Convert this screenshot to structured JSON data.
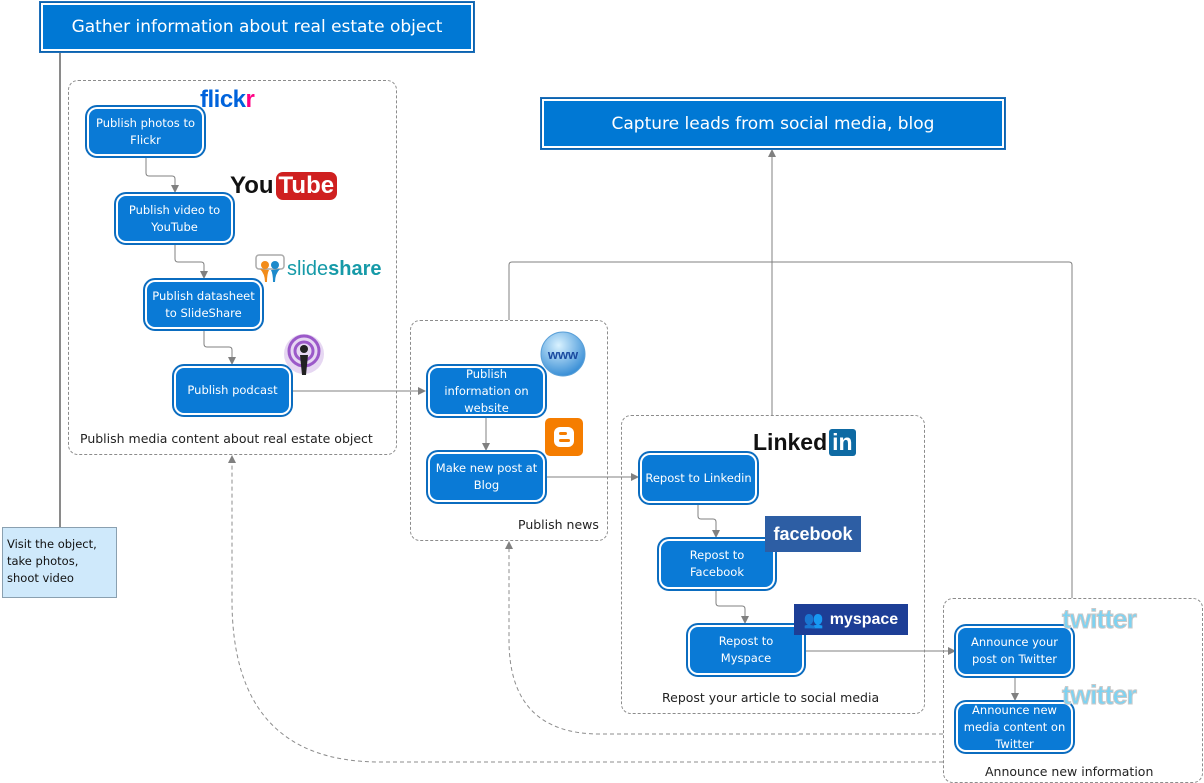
{
  "header": {
    "gather_title": "Gather information about real estate object",
    "capture_title": "Capture leads from social media, blog"
  },
  "note": {
    "text_lines": [
      "Visit the object,",
      "take photos,",
      "shoot video"
    ]
  },
  "groups": {
    "media": {
      "label": "Publish media content about real estate object",
      "steps": [
        {
          "label": "Publish photos to Flickr",
          "logo": "flickr"
        },
        {
          "label": "Publish video to YouTube",
          "logo": "youtube"
        },
        {
          "label": "Publish datasheet to SlideShare",
          "logo": "slideshare"
        },
        {
          "label": "Publish podcast",
          "logo": "podcast"
        }
      ]
    },
    "news": {
      "label": "Publish news",
      "steps": [
        {
          "label": "Publish information on website",
          "logo": "www"
        },
        {
          "label": "Make new post at Blog",
          "logo": "blogger"
        }
      ]
    },
    "social": {
      "label": "Repost your article to social media",
      "steps": [
        {
          "label": "Repost to Linkedin",
          "logo": "linkedin"
        },
        {
          "label": "Repost to Facebook",
          "logo": "facebook"
        },
        {
          "label": "Repost to Myspace",
          "logo": "myspace"
        }
      ]
    },
    "announce": {
      "label": "Announce new information",
      "steps": [
        {
          "label": "Announce your post on Twitter",
          "logo": "twitter"
        },
        {
          "label": "Announce new media content on Twitter",
          "logo": "twitter"
        }
      ]
    }
  },
  "logos": {
    "flickr": {
      "part1": "flick",
      "part2": "r",
      "color1": "#0063dc",
      "color2": "#ff0084"
    },
    "youtube": {
      "part1": "You",
      "part2": "Tube"
    },
    "slideshare": {
      "part1": "slide",
      "part2": "share"
    },
    "www": {
      "text": "www"
    },
    "linkedin": {
      "part1": "Linked",
      "part2": "in"
    },
    "facebook": {
      "text": "facebook"
    },
    "myspace": {
      "text": "myspace"
    },
    "twitter": {
      "text": "twitter"
    }
  },
  "colors": {
    "box_fill": "#0a7ad6",
    "title_fill": "#0078d4",
    "note_fill": "#cfe9fb",
    "connector": "#808080"
  }
}
